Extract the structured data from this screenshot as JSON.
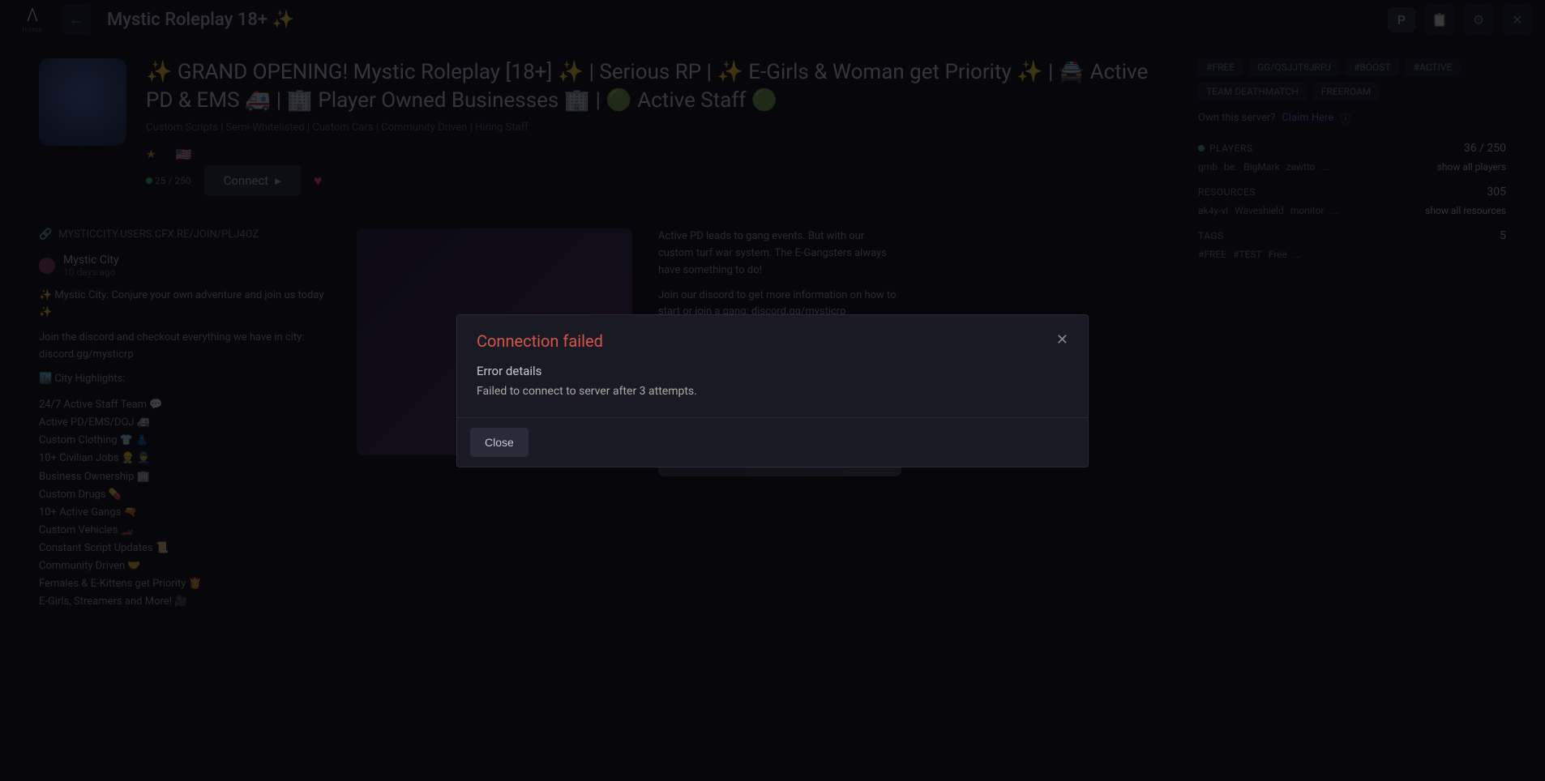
{
  "topbar": {
    "logo_label": "Home",
    "back_icon": "←",
    "title": "Mystic Roleplay 18+ ✨",
    "user_letter": "P",
    "icons": {
      "changelog": "📋",
      "settings": "⚙",
      "close": "✕"
    }
  },
  "server": {
    "title": "✨ GRAND OPENING! Mystic Roleplay [18+] ✨ | Serious RP | ✨ E-Girls & Woman get Priority ✨ | 🚔 Active PD & EMS 🚑 | 🏢 Player Owned Businesses 🏢 | 🟢 Active Staff 🟢",
    "subtitle": "Custom Scripts | Semi-Whitelisted | Custom Cars | Community Driven | Hiring Staff",
    "star": "★",
    "flag": "🇺🇸",
    "player_inline": "25 / 250",
    "connect_label": "Connect",
    "heart": "♥"
  },
  "sidebar": {
    "tags": [
      "#FREE",
      "GG/QSJJT8JRPJ",
      "#BOOST",
      "#ACTIVE",
      "TEAM DEATHMATCH",
      "FREEROAM"
    ],
    "owner_prefix": "Own this server? ",
    "owner_link": "Claim Here",
    "owner_icon": "ⓘ",
    "players": {
      "label": "PLAYERS",
      "value": "36 / 250",
      "items": [
        "gmb",
        "be.",
        "BigMark",
        "zawtto",
        "..."
      ],
      "show": "show all players"
    },
    "resources": {
      "label": "RESOURCES",
      "value": "305",
      "items": [
        "ak4y-vi",
        "Waveshield",
        "monitor",
        "..."
      ],
      "show": "show all resources"
    },
    "tags_section": {
      "label": "TAGS",
      "value": "5",
      "items": [
        "#FREE",
        "#TEST",
        "Free",
        "..."
      ]
    }
  },
  "desc": {
    "url": "MYSTICCITY.USERS.CFX.RE/JOIN/PLJ4OZ",
    "post_name": "Mystic City",
    "post_time": "10 days ago",
    "line_intro": "✨ Mystic City: Conjure your own adventure and join us today ✨",
    "line_discord": "Join the discord and checkout everything we have in city: discord.gg/mysticrp",
    "highlights_label": "🏙️ City Highlights:",
    "list": [
      "24/7 Active Staff Team 💬",
      "Active PD/EMS/DOJ 🚑",
      "Custom Clothing 👕 👗",
      "10+ Civilian Jobs 👷 👮",
      "Business Ownership 🏢",
      "Custom Drugs 💊",
      "10+ Active Gangs 🔫",
      "Custom Vehicles 🏎️",
      "Constant Script Updates 📜",
      "Community Driven 🤝",
      "Females & E-Kittens get Priority 👸",
      "E-Girls, Streamers and More! 🎥"
    ],
    "right_text1": "Active PD leads to gang events. But with our custom turf war system. The E-Gangsters always have something to do!",
    "right_text2": "Join our discord to get more information on how to start or join a gang: discord.gg/mysticrp"
  },
  "modal": {
    "title": "Connection failed",
    "subtitle": "Error details",
    "text": "Failed to connect to server after 3 attempts.",
    "close_label": "Close",
    "x": "✕"
  }
}
